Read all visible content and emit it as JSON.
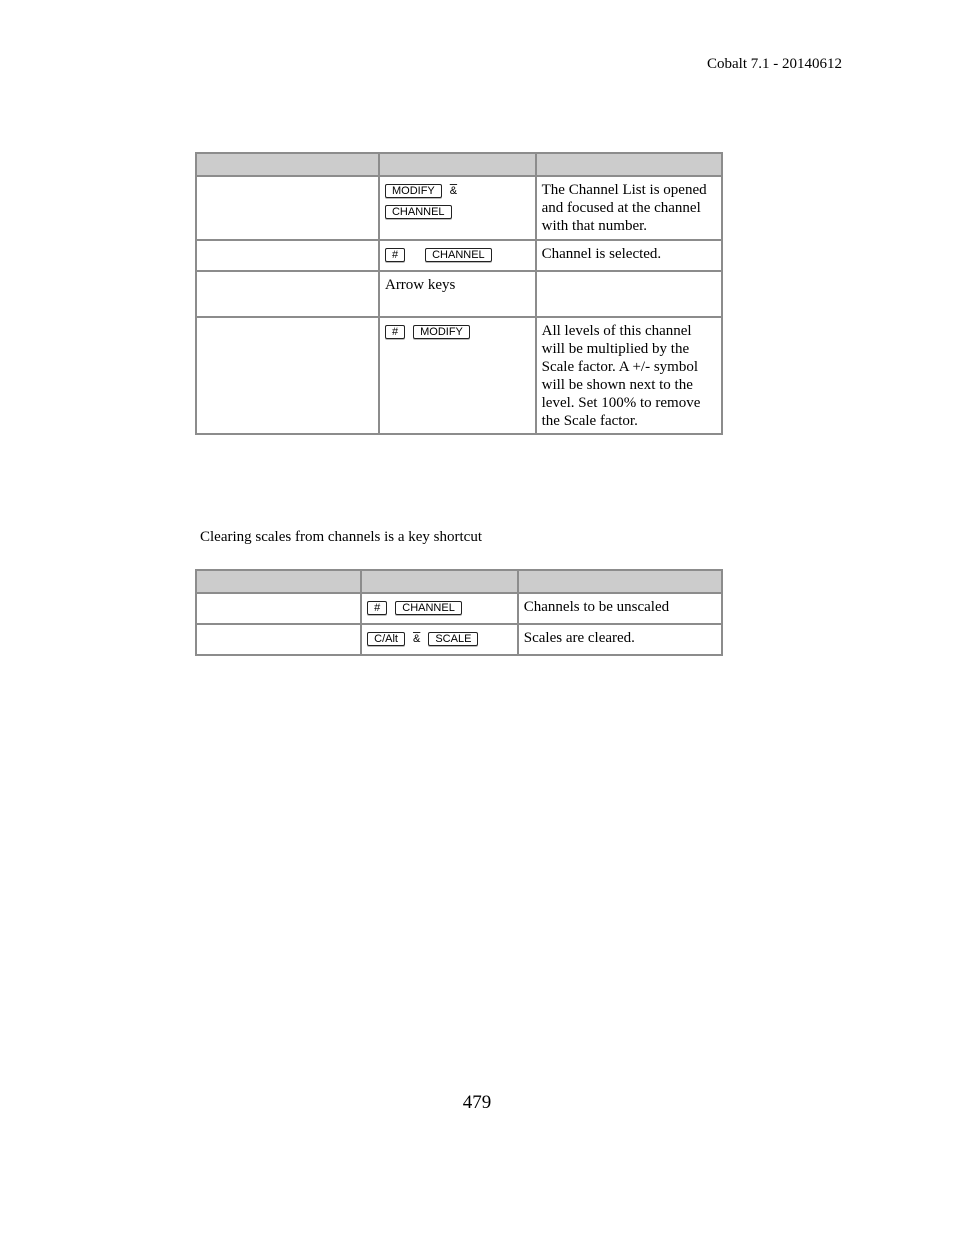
{
  "header": {
    "text": "Cobalt 7.1 - 20140612"
  },
  "table1": {
    "headers": [
      "",
      "",
      ""
    ],
    "rows": [
      {
        "action": "",
        "keys_lines": [
          [
            "MODIFY",
            "&"
          ],
          [
            "CHANNEL"
          ]
        ],
        "result": "The Channel List is opened and focused at the channel with that number."
      },
      {
        "action": "",
        "keys_lines": [
          [
            "#",
            "CHANNEL"
          ]
        ],
        "result": "Channel is selected."
      },
      {
        "action": "",
        "keys_text": "Arrow keys",
        "result": ""
      },
      {
        "action": "",
        "keys_lines": [
          [
            "#",
            "MODIFY"
          ]
        ],
        "result": "All levels of this channel will be multiplied by the Scale factor. A +/- symbol will be shown next to the level. Set 100% to remove the Scale factor."
      }
    ]
  },
  "intro_text": "Clearing scales from channels is a key shortcut",
  "table2": {
    "headers": [
      "",
      "",
      ""
    ],
    "rows": [
      {
        "action": "",
        "keys_lines": [
          [
            "#",
            "CHANNEL"
          ]
        ],
        "result": "Channels to be unscaled"
      },
      {
        "action": "",
        "keys_lines": [
          [
            "C/Alt",
            "&",
            "SCALE"
          ]
        ],
        "result": "Scales are cleared."
      }
    ]
  },
  "footer": {
    "page_number": "479"
  }
}
